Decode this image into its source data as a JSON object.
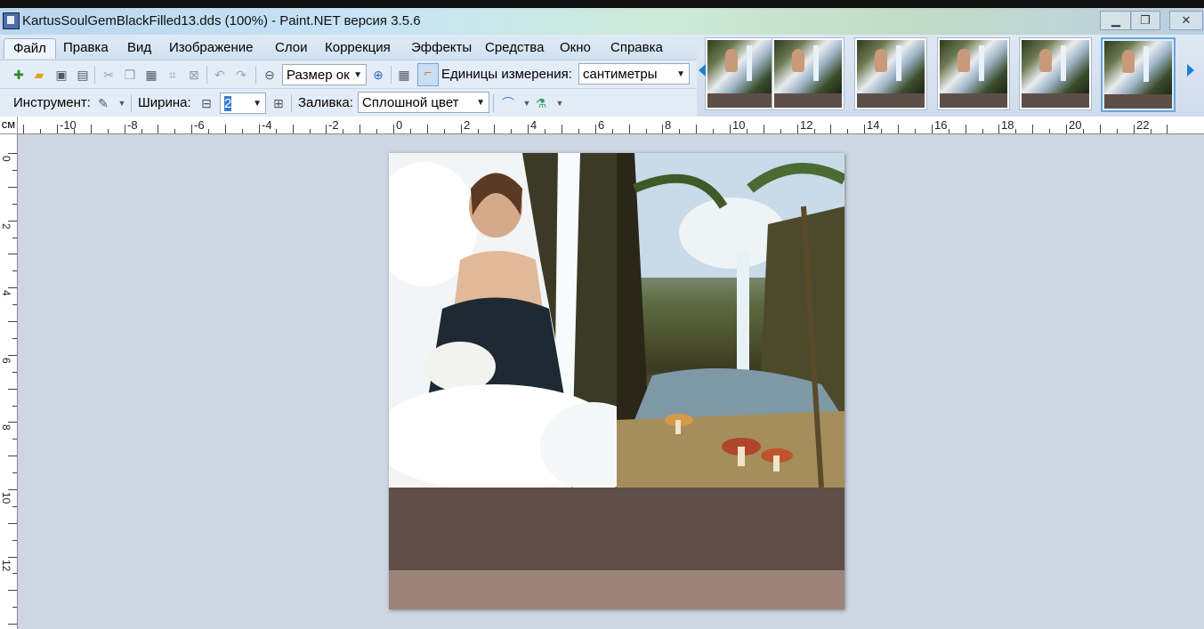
{
  "window": {
    "title": "KartusSoulGemBlackFilled13.dds (100%) - Paint.NET версия 3.5.6",
    "minimize_glyph": "▁",
    "maximize_glyph": "❐",
    "close_glyph": "✕"
  },
  "menu": [
    "Файл",
    "Правка",
    "Вид",
    "Изображение",
    "Слои",
    "Коррекция",
    "Эффекты",
    "Средства",
    "Окно",
    "Справка"
  ],
  "toolbar": {
    "zoom_value": "Размер ок",
    "units_label": "Единицы измерения:",
    "units_value": "сантиметры"
  },
  "tool_options": {
    "tool_label": "Инструмент:",
    "width_label": "Ширина:",
    "width_value": "2",
    "fill_label": "Заливка:",
    "fill_value": "Сплошной цвет"
  },
  "ruler": {
    "unit": "см",
    "h_labels": [
      "-10",
      "-8",
      "-6",
      "-4",
      "-2",
      "0",
      "2",
      "4",
      "6",
      "8",
      "10",
      "12",
      "14",
      "16",
      "18",
      "20",
      "22",
      "2"
    ],
    "v_labels": [
      "0",
      "2",
      "4",
      "6",
      "8",
      "10",
      "12"
    ]
  },
  "images": {
    "thumbnail_count": 6,
    "selected_thumbnail": 6
  },
  "colors": {
    "canvas_brown": "#5f4f48",
    "canvas_tan": "#9c837a",
    "workspace": "#cdd6e2"
  }
}
